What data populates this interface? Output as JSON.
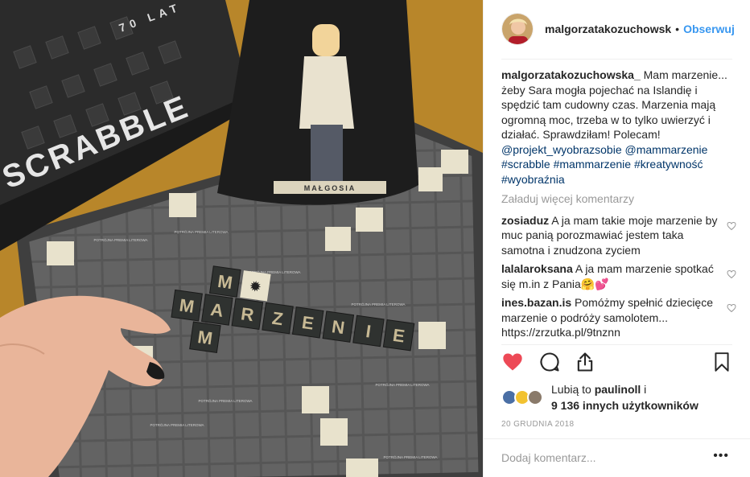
{
  "photo": {
    "box_title": "SCRABBLE",
    "box_subtitle": "70 LAT",
    "bag_label": "MAŁGOSIA",
    "word_main": [
      "M",
      "A",
      "R",
      "Z",
      "E",
      "N",
      "I",
      "E"
    ],
    "word_top": "M",
    "word_bottom": "M",
    "premium_label": "POTRÓJNA PREMIA LITEROWA",
    "colors": {
      "table": "#b8862a",
      "board": "#5c5c5c",
      "tile": "#2f3230",
      "tile_letter": "#c7b994"
    }
  },
  "header": {
    "username": "malgorzatakozuchowsk",
    "follow": "Obserwuj"
  },
  "caption": {
    "user": "malgorzatakozuchowska_",
    "text": "Mam marzenie... żeby Sara mogła pojechać na Islandię i spędzić tam cudowny czas. Marzenia mają ogromną moc, trzeba w to tylko uwierzyć i działać. Sprawdziłam! Polecam!",
    "tags": "@projekt_wyobrazsobie @mammarzenie #scrabble #mammarzenie #kreatywność #wyobraźnia"
  },
  "load_more": "Załaduj więcej komentarzy",
  "comments": [
    {
      "user": "zosiaduz",
      "text": "A ja mam takie moje marzenie by muc panią porozmawiać jestem taka samotna i znudzona zyciem"
    },
    {
      "user": "lalalaroksana",
      "text": "A ja mam marzenie spotkać się m.in z Pania🤗💕"
    },
    {
      "user": "ines.bazan.is",
      "text": "Pomóżmy spełnić dziecięce marzenie o podróży samolotem... https://zrzutka.pl/9tnznn"
    }
  ],
  "likes": {
    "prefix": "Lubią to",
    "user": "paulinoll",
    "middle": "i",
    "count": "9 136 innych użytkowników"
  },
  "date": "20 GRUDNIA 2018",
  "add_comment_placeholder": "Dodaj komentarz...",
  "more_label": "•••",
  "icons": [
    "heart-icon",
    "comment-icon",
    "share-icon",
    "bookmark-icon",
    "more-icon"
  ],
  "accent": "#3897f0",
  "like_color": "#ed4956"
}
